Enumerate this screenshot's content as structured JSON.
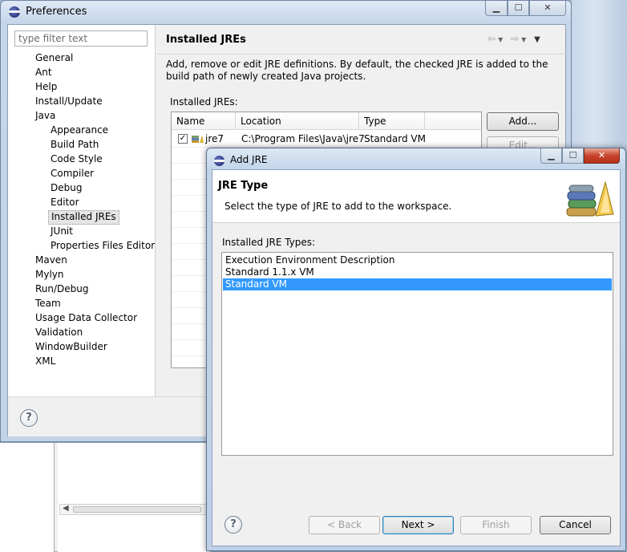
{
  "preferences": {
    "title": "Preferences",
    "filter_placeholder": "type filter text",
    "tree": [
      "General",
      "Ant",
      "Help",
      "Install/Update",
      "Java",
      "Appearance",
      "Build Path",
      "Code Style",
      "Compiler",
      "Debug",
      "Editor",
      "Installed JREs",
      "JUnit",
      "Properties Files Editor",
      "Maven",
      "Mylyn",
      "Run/Debug",
      "Team",
      "Usage Data Collector",
      "Validation",
      "WindowBuilder",
      "XML"
    ],
    "selected_tree_item": "Installed JREs",
    "page_title": "Installed JREs",
    "description": "Add, remove or edit JRE definitions. By default, the checked JRE is added to the build path of newly created Java projects.",
    "installed_label": "Installed JREs:",
    "table": {
      "columns": [
        "Name",
        "Location",
        "Type"
      ],
      "rows": [
        {
          "checked": true,
          "name": "jre7",
          "location": "C:\\Program Files\\Java\\jre7",
          "type": "Standard VM"
        }
      ]
    },
    "buttons": {
      "add": "Add...",
      "edit": "Edit..."
    },
    "help_glyph": "?"
  },
  "add_jre": {
    "title": "Add JRE",
    "banner_title": "JRE Type",
    "banner_desc": "Select the type of JRE to add to the workspace.",
    "types_label": "Installed JRE Types:",
    "types": [
      "Execution Environment Description",
      "Standard 1.1.x VM",
      "Standard VM"
    ],
    "selected_type": "Standard VM",
    "buttons": {
      "back": "< Back",
      "next": "Next >",
      "finish": "Finish",
      "cancel": "Cancel"
    },
    "help_glyph": "?"
  },
  "colors": {
    "selection": "#3399ff",
    "close_button": "#c7422b",
    "title_bar": "#c5d6ea"
  }
}
